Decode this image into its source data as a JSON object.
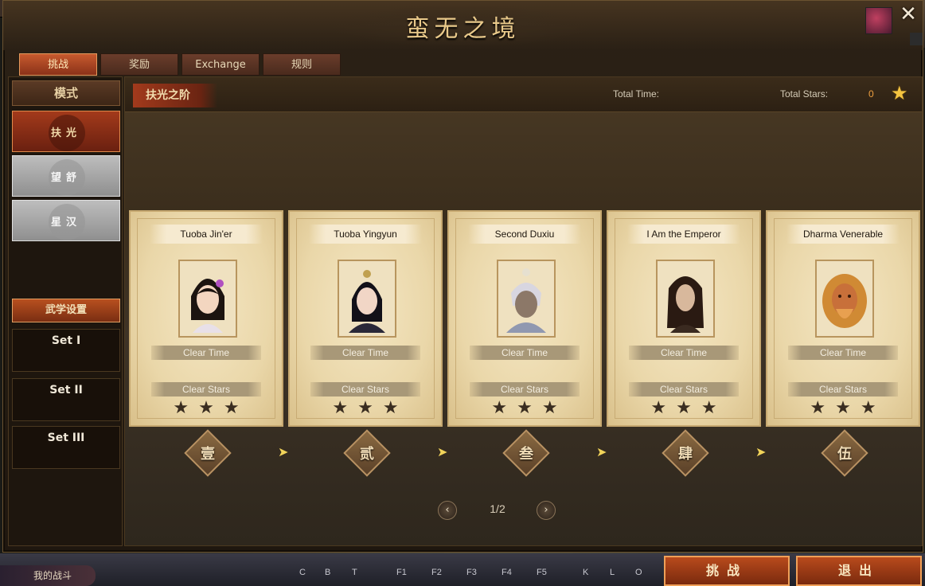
{
  "window": {
    "title": "蛮无之境",
    "close": "✕"
  },
  "tabs": [
    {
      "label": "挑战",
      "active": true
    },
    {
      "label": "奖励",
      "active": false
    },
    {
      "label": "Exchange",
      "active": false
    },
    {
      "label": "规则",
      "active": false
    }
  ],
  "sidebar": {
    "mode_header": "模式",
    "modes": [
      {
        "label": "扶光",
        "active": true
      },
      {
        "label": "望舒",
        "active": false
      },
      {
        "label": "星汉",
        "active": false
      }
    ],
    "martial_button": "武学设置",
    "sets": [
      "Set I",
      "Set II",
      "Set III"
    ]
  },
  "stage_bar": {
    "stage_name": "扶光之阶",
    "total_time_label": "Total Time:",
    "total_stars_label": "Total Stars:",
    "total_stars_value": "0"
  },
  "cards": [
    {
      "name": "Tuoba Jin'er",
      "clear_time": "Clear Time",
      "clear_stars": "Clear Stars",
      "stars": 3,
      "icon": "female-portrait-icon"
    },
    {
      "name": "Tuoba Yingyun",
      "clear_time": "Clear Time",
      "clear_stars": "Clear Stars",
      "stars": 3,
      "icon": "female-portrait-icon"
    },
    {
      "name": "Second Duxiu",
      "clear_time": "Clear Time",
      "clear_stars": "Clear Stars",
      "stars": 3,
      "icon": "male-portrait-icon"
    },
    {
      "name": "I Am the Emperor",
      "clear_time": "Clear Time",
      "clear_stars": "Clear Stars",
      "stars": 3,
      "icon": "male-portrait-icon"
    },
    {
      "name": "Dharma Venerable",
      "clear_time": "Clear Time",
      "clear_stars": "Clear Stars",
      "stars": 3,
      "icon": "lion-portrait-icon"
    }
  ],
  "stages": [
    "壹",
    "贰",
    "叁",
    "肆",
    "伍"
  ],
  "pager": {
    "text": "1/2",
    "prev": "‹",
    "next": "›"
  },
  "footer": {
    "battle_label": "我的战斗",
    "challenge_button": "挑战",
    "exit_button": "退出",
    "hotkeys": [
      "C",
      "B",
      "T",
      "F1",
      "F2",
      "F3",
      "F4",
      "F5",
      "K",
      "L",
      "O"
    ]
  },
  "colors": {
    "accent": "#c75a2e",
    "star_gold": "#f4c440",
    "star_count": "#f0a040"
  }
}
